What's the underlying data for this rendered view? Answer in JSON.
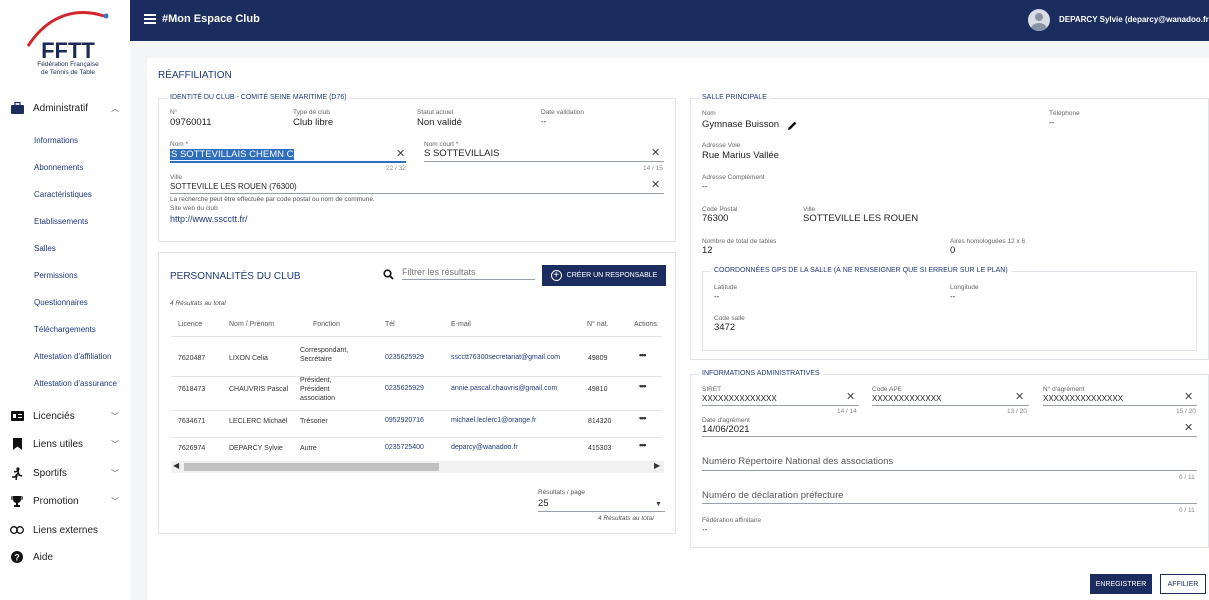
{
  "logo": {
    "brand": "FFTT",
    "line1": "Fédération Française",
    "line2": "de Tennis de Table"
  },
  "nav": {
    "administratif": "Administratif",
    "sub": [
      "Informations",
      "Abonnements",
      "Caractéristiques",
      "Etablissements",
      "Salles",
      "Permissions",
      "Questionnaires",
      "Téléchargements",
      "Attestation d'affiliation",
      "Attestation d'assurance"
    ],
    "licencies": "Licenciés",
    "liens_utiles": "Liens utiles",
    "sportifs": "Sportifs",
    "promotion": "Promotion",
    "liens_externes": "Liens externes",
    "aide": "Aide"
  },
  "header": {
    "title": "#Mon Espace Club",
    "user": "DEPARCY Sylvie (deparcy@wanadoo.fr"
  },
  "page": {
    "title": "RÉAFFILIATION"
  },
  "identite": {
    "legend": "IDENTITÉ DU CLUB - COMITÉ SEINE MARITIME (D76)",
    "no_label": "N°",
    "no_value": "09760011",
    "type_label": "Type de club",
    "type_value": "Club libre",
    "statut_label": "Statut actuel",
    "statut_value": "Non validé",
    "date_label": "Date validation",
    "date_value": "--",
    "nom_label": "Nom *",
    "nom_value": "S SOTTEVILLAIS CHEMN C",
    "nom_count": "22 / 32",
    "court_label": "Nom court *",
    "court_value": "S SOTTEVILLAIS",
    "court_count": "14 / 15",
    "ville_label": "Ville",
    "ville_value": "SOTTEVILLE LES ROUEN (76300)",
    "ville_hint": "La recherche peut être effectuée par code postal ou nom de commune.",
    "site_label": "Site web du club",
    "site_value": "http://www.sscctt.fr/"
  },
  "personnalites": {
    "title": "PERSONNALITÉS DU CLUB",
    "filter_placeholder": "Filtrer les résultats",
    "create_label": "CRÉER UN RESPONSABLE",
    "count_top": "4 Résultats au total",
    "columns": [
      "Licence",
      "Nom / Prénom",
      "Fonction",
      "Tél",
      "E-mail",
      "N° nat.",
      "Actions"
    ],
    "rows": [
      {
        "licence": "7620487",
        "nom": "LIXON Celia",
        "fonction": "Correspondant, Secrétaire",
        "tel": "0235625929",
        "email": "sscctt76300secretariat@gmail.com",
        "nat": "49809"
      },
      {
        "licence": "7618473",
        "nom": "CHAUVRIS Pascal",
        "fonction": "Président, Président association",
        "tel": "0235625929",
        "email": "annie.pascal.chauvris@gmail.com",
        "nat": "49810"
      },
      {
        "licence": "7634671",
        "nom": "LECLERC Michaël",
        "fonction": "Trésorier",
        "tel": "0952920716",
        "email": "michael.leclerc1@orange.fr",
        "nat": "814320"
      },
      {
        "licence": "7626974",
        "nom": "DEPARCY Sylvie",
        "fonction": "Autre",
        "tel": "0235725400",
        "email": "deparcy@wanadoo.fr",
        "nat": "415303"
      }
    ],
    "per_page_label": "Résultats / page",
    "per_page_value": "25",
    "count_bottom": "4 Résultats au total"
  },
  "salle": {
    "legend": "SALLE PRINCIPALE",
    "nom_label": "Nom",
    "nom_value": "Gymnase Buisson",
    "tel_label": "Téléphone",
    "tel_value": "--",
    "voie_label": "Adresse Voie",
    "voie_value": "Rue Marius Vallée",
    "comp_label": "Adresse Complément",
    "comp_value": "--",
    "cp_label": "Code Postal",
    "cp_value": "76300",
    "ville_label": "Ville",
    "ville_value": "SOTTEVILLE LES ROUEN",
    "tables_label": "Nombre de total de tables",
    "tables_value": "12",
    "aires_label": "Aires homologuées 12 x 6",
    "aires_value": "0",
    "gps_legend": "COORDONNÉES GPS DE LA SALLE (À NE RENSEIGNER QUE SI ERREUR SUR LE PLAN)",
    "lat_label": "Latitude",
    "lat_value": "--",
    "lng_label": "Longitude",
    "lng_value": "--",
    "code_label": "Code salle",
    "code_value": "3472"
  },
  "admin": {
    "legend": "INFORMATIONS ADMINISTRATIVES",
    "siret_label": "SIRET",
    "siret_value": "XXXXXXXXXXXXXX",
    "siret_count": "14 / 14",
    "ape_label": "Code APE",
    "ape_value": "XXXXXXXXXXXXX",
    "ape_count": "13 / 20",
    "agrement_label": "N° d'agrément",
    "agrement_value": "XXXXXXXXXXXXXXX",
    "agrement_count": "15 / 20",
    "date_label": "Date d'agrément",
    "date_value": "14/06/2021",
    "rna_placeholder": "Numéro Répertoire National des associations",
    "rna_count": "0 / 11",
    "pref_placeholder": "Numéro de déclaration préfecture",
    "pref_count": "0 / 11",
    "fed_label": "Fédération affinitaire",
    "fed_value": "--"
  },
  "actions": {
    "save": "ENREGISTRER",
    "affilier": "AFFILIER"
  },
  "colors": {
    "navy": "#1b2c5e",
    "link": "#1f3a7a",
    "button": "#1b2c5e"
  }
}
